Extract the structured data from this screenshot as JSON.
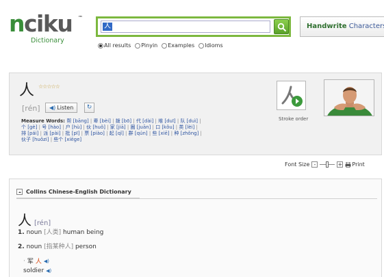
{
  "logo": {
    "n": "n",
    "rest": "ciku",
    "tm": "™",
    "sub": "Dictionary"
  },
  "search": {
    "value": "人",
    "button_label": "search"
  },
  "handwrite": {
    "bold": "Handwrite",
    "rest": " Characters"
  },
  "search_options": [
    {
      "label": "All results",
      "checked": true
    },
    {
      "label": "Pinyin",
      "checked": false
    },
    {
      "label": "Examples",
      "checked": false
    },
    {
      "label": "Idioms",
      "checked": false
    }
  ],
  "word": {
    "character": "人",
    "stars": "☆☆☆☆☆",
    "pinyin": "[rén]",
    "listen_label": "Listen",
    "measure_label": "Measure Words:",
    "measure_words": [
      "帮 [bāng]",
      "辈 [bèi]",
      "拨 [bō]",
      "代 [dài]",
      "堆 [duī]",
      "队 [duì]",
      "个 [gè]",
      "号 [hào]",
      "户 [hù]",
      "伙 [huǒ]",
      "家 [jiā]",
      "圈 [juān]",
      "口 [kǒu]",
      "类 [lèi]",
      "排 [pái]",
      "派 [pài]",
      "批 [pī]",
      "票 [piào]",
      "起 [qǐ]",
      "群 [qún]",
      "些 [xiē]",
      "种 [zhǒng]",
      "伙子 [huǒzi]",
      "些个 [xiēge]"
    ],
    "measure_lines": [
      [
        0,
        6
      ],
      [
        6,
        14
      ],
      [
        14,
        22
      ],
      [
        22,
        24
      ]
    ],
    "stroke_order_label": "Stroke order"
  },
  "font_size": {
    "label": "Font Size",
    "minus": "-",
    "plus": "+",
    "print_label": "Print"
  },
  "collins": {
    "title": "Collins Chinese-English Dictionary",
    "character": "人",
    "pinyin": "[rén]",
    "senses": [
      {
        "num": "1.",
        "pos": "noun",
        "cn": "[人类]",
        "en": "human being"
      },
      {
        "num": "2.",
        "pos": "noun",
        "cn": "[指某种人]",
        "en": "person"
      }
    ],
    "example": {
      "prefix": "军",
      "highlight": "人",
      "translation": "soldier"
    }
  },
  "colors": {
    "brand_green": "#3a8e3a",
    "search_border": "#7cb83e",
    "link_blue": "#2b52a0",
    "highlight_orange": "#d9480f"
  }
}
